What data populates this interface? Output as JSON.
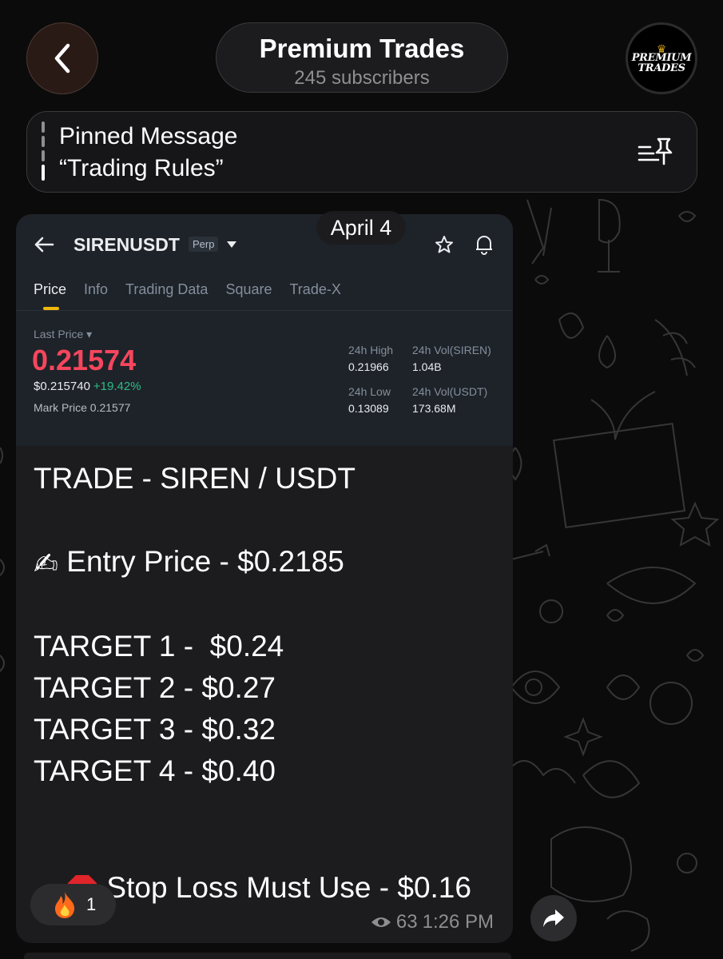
{
  "header": {
    "channel_name": "Premium Trades",
    "subscribers": "245 subscribers",
    "avatar_text_line1": "PREMIUM",
    "avatar_text_line2": "TRADES"
  },
  "pinned": {
    "label": "Pinned Message",
    "text": "“Trading Rules”"
  },
  "date_badge": "April 4",
  "screenshot": {
    "symbol": "SIRENUSDT",
    "badge": "Perp",
    "tabs": [
      "Price",
      "Info",
      "Trading Data",
      "Square",
      "Trade-X"
    ],
    "last_price_label": "Last Price",
    "last_price": "0.21574",
    "usd_price": "$0.215740",
    "change": "+19.42%",
    "mark_price": "Mark Price 0.21577",
    "stats": [
      {
        "label": "24h High",
        "value": "0.21966"
      },
      {
        "label": "24h Vol(SIREN)",
        "value": "1.04B"
      },
      {
        "label": "24h Low",
        "value": "0.13089"
      },
      {
        "label": "24h Vol(USDT)",
        "value": "173.68M"
      }
    ]
  },
  "message": {
    "title": "TRADE - SIREN / USDT",
    "entry": "Entry Price - $0.2185",
    "targets": [
      "TARGET 1 -  $0.24",
      "TARGET 2 - $0.27",
      "TARGET 3 - $0.32",
      "TARGET 4 - $0.40"
    ],
    "stop_loss": "Stop Loss Must Use - $0.16",
    "reaction_count": "1",
    "views": "63",
    "time": "1:26 PM"
  },
  "colors": {
    "down_red": "#f6465d",
    "up_green": "#2ebd85",
    "accent_yellow": "#f0b90b"
  }
}
